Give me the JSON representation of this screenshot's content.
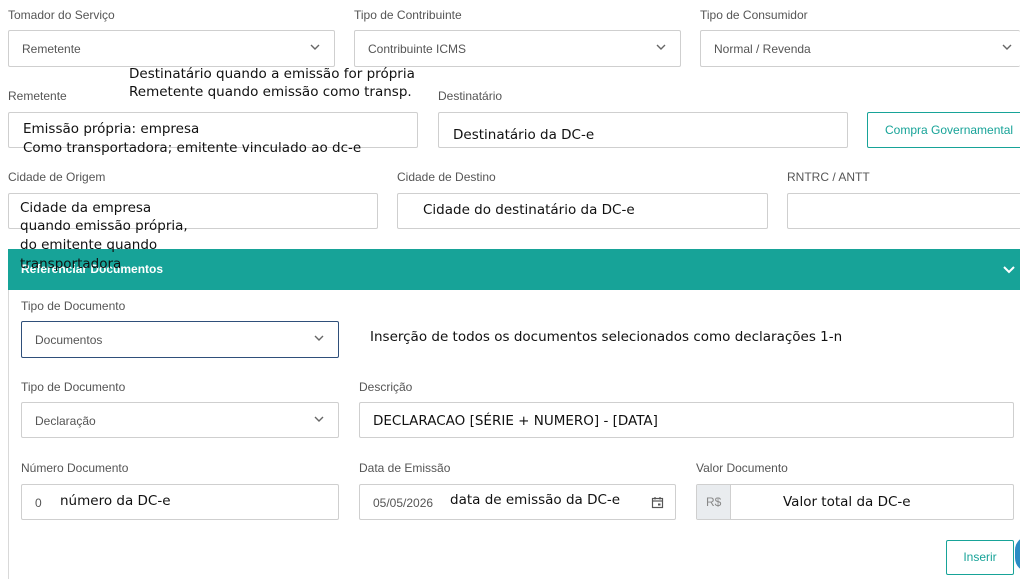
{
  "top": {
    "tomador": {
      "label": "Tomador do Serviço",
      "value": "Remetente"
    },
    "tipo_contribuinte": {
      "label": "Tipo de Contribuinte",
      "value": "Contribuinte ICMS"
    },
    "tipo_consumidor": {
      "label": "Tipo de Consumidor",
      "value": "Normal / Revenda"
    }
  },
  "parties": {
    "note_line1": "Destinatário quando a emissão for própria",
    "note_line2": "Remetente quando emissão como transp.",
    "remetente": {
      "label": "Remetente",
      "line1": "Emissão própria: empresa",
      "line2": "Como transportadora; emitente vinculado ao dc-e"
    },
    "destinatario": {
      "label": "Destinatário",
      "text": "Destinatário da DC-e"
    },
    "compra_governamental": "Compra Governamental"
  },
  "cities": {
    "origem": {
      "label": "Cidade de Origem",
      "line1": "Cidade da empresa",
      "line2": "quando emissão própria,",
      "line3": "do emitente quando",
      "line4": "transportadora"
    },
    "destino": {
      "label": "Cidade de Destino",
      "text": "Cidade do destinatário da DC-e"
    },
    "rntrc": {
      "label": "RNTRC / ANTT",
      "value": ""
    }
  },
  "section": {
    "title": "Referenciar Documentos"
  },
  "documents": {
    "tipo1": {
      "label": "Tipo de Documento",
      "value": "Documentos"
    },
    "tipo1_note": "Inserção de todos os documentos selecionados como declarações 1-n",
    "tipo2": {
      "label": "Tipo de Documento",
      "value": "Declaração"
    },
    "descricao": {
      "label": "Descrição",
      "value": "DECLARACAO [SÉRIE + NUMERO] - [DATA]"
    },
    "numero": {
      "label": "Número Documento",
      "value": "0",
      "note": "número da DC-e"
    },
    "data": {
      "label": "Data de Emissão",
      "value": "05/05/2026",
      "note": "data de emissão da DC-e"
    },
    "valor": {
      "label": "Valor Documento",
      "prefix": "R$",
      "note": "Valor total da DC-e"
    },
    "inserir": "Inserir"
  },
  "colors": {
    "accent": "#17a398",
    "border": "#cfcfcf",
    "focus_border": "#2f4f7a"
  }
}
